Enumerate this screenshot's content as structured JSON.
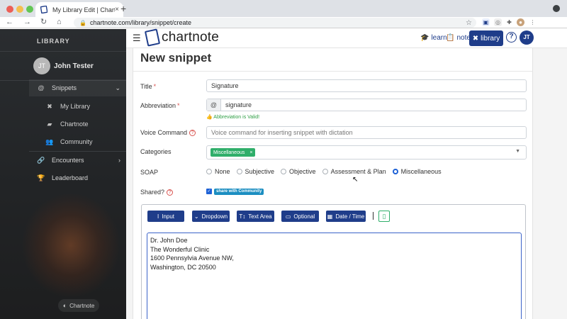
{
  "browser": {
    "tab_title": "My Library Edit | Chartnote",
    "tab_close": "×",
    "new_tab": "+",
    "url": "chartnote.com/library/snippet/create",
    "ext_avatar": "●"
  },
  "sidebar": {
    "heading": "LIBRARY",
    "user_initials": "JT",
    "user_name": "John Tester",
    "items": [
      {
        "label": "Snippets",
        "icon": "@"
      },
      {
        "label": "My Library",
        "icon": "✖"
      },
      {
        "label": "Chartnote",
        "icon": "▰"
      },
      {
        "label": "Community",
        "icon": "👥"
      },
      {
        "label": "Encounters",
        "icon": "🔗"
      },
      {
        "label": "Leaderboard",
        "icon": "🏆"
      }
    ],
    "footer_label": "Chartnote"
  },
  "header": {
    "logo_text": "chartnote",
    "learn_label": "learn",
    "note_label": "note",
    "library_label": "library",
    "help": "?",
    "avatar_initials": "JT"
  },
  "form": {
    "page_title": "New snippet",
    "title_label": "Title",
    "title_value": "Signature",
    "abbrev_label": "Abbreviation",
    "abbrev_prefix": "@",
    "abbrev_value": "signature",
    "abbrev_valid": "Abbreviation is Valid!",
    "voice_label": "Voice Command",
    "voice_placeholder": "Voice command for inserting snippet with dictation",
    "categories_label": "Categories",
    "category_tag": "Miscellaneous",
    "tag_remove": "×",
    "soap_label": "SOAP",
    "soap_options": [
      "None",
      "Subjective",
      "Objective",
      "Assessment & Plan",
      "Miscellaneous"
    ],
    "soap_selected": "Miscellaneous",
    "shared_label": "Shared?",
    "share_pill": "share with Community",
    "required_mark": "*",
    "help_mark": "?"
  },
  "editor": {
    "buttons": [
      {
        "label": "Input",
        "icon": "I"
      },
      {
        "label": "Dropdown",
        "icon": "⌄"
      },
      {
        "label": "Text Area",
        "icon": "T↕"
      },
      {
        "label": "Optional",
        "icon": "▭"
      },
      {
        "label": "Date / Time",
        "icon": "▦"
      }
    ],
    "content_lines": [
      "Dr. John Doe",
      "The Wonderful Clinic",
      "1600 Pennsylvia Avenue NW,",
      "Washington, DC 20500"
    ]
  },
  "colors": {
    "primary": "#1f3d8a",
    "success": "#2fae6a",
    "danger": "#d9534f",
    "info": "#1c8ec1"
  }
}
